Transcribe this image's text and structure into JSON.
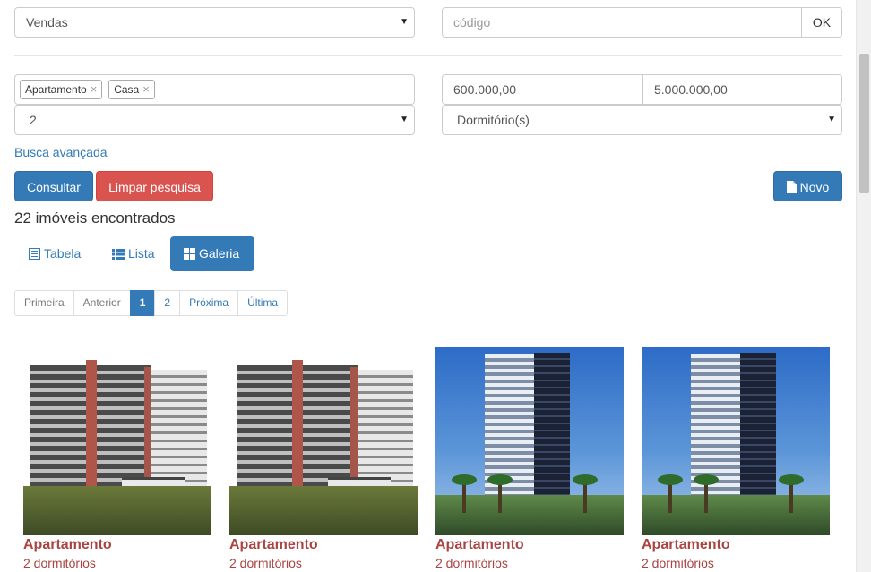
{
  "filters": {
    "category_select": "Vendas",
    "code_input_placeholder": "código",
    "code_ok_label": "OK",
    "type_tags": [
      "Apartamento",
      "Casa"
    ],
    "tag_remove_glyph": "×",
    "price_min": "600.000,00",
    "price_max": "5.000.000,00",
    "quantity_select": "2",
    "rooms_select": "Dormitório(s)",
    "advanced_search_link": "Busca avançada"
  },
  "actions": {
    "search_label": "Consultar",
    "clear_label": "Limpar pesquisa",
    "new_label": "Novo"
  },
  "results": {
    "count_text": "22 imóveis encontrados"
  },
  "views": {
    "table_label": "Tabela",
    "list_label": "Lista",
    "gallery_label": "Galeria",
    "active": "Galeria"
  },
  "pagination": {
    "first": "Primeira",
    "previous": "Anterior",
    "pages": [
      "1",
      "2"
    ],
    "current": "1",
    "next": "Próxima",
    "last": "Última"
  },
  "cards": [
    {
      "title": "Apartamento",
      "subtitle": "2 dormitórios",
      "image": "older-building-photo"
    },
    {
      "title": "Apartamento",
      "subtitle": "2 dormitórios",
      "image": "older-building-photo"
    },
    {
      "title": "Apartamento",
      "subtitle": "2 dormitórios",
      "image": "modern-tower-photo"
    },
    {
      "title": "Apartamento",
      "subtitle": "2 dormitórios",
      "image": "modern-tower-photo"
    }
  ],
  "colors": {
    "primary": "#337ab7",
    "danger": "#d9534f",
    "card_title": "#a94442"
  }
}
